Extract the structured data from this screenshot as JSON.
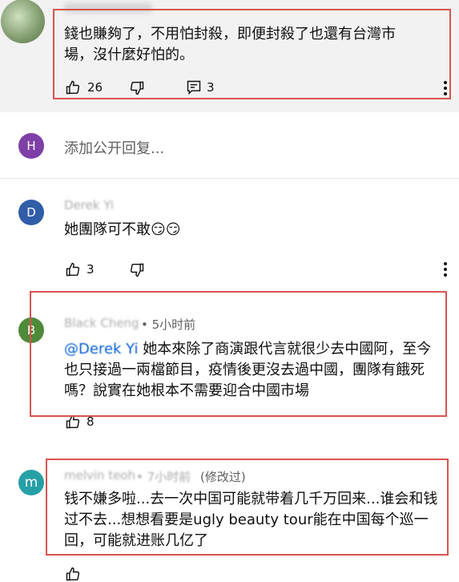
{
  "comment1": {
    "text": "錢也賺夠了，不用怕封殺，即便封殺了也還有台灣市場，沒什麼好怕的。",
    "likes": "26",
    "replies": "3"
  },
  "reply_box": {
    "avatar_letter": "H",
    "placeholder": "添加公开回复..."
  },
  "comment2": {
    "avatar_letter": "D",
    "author": "Derek Yi",
    "text": "她團隊可不敢😏😏",
    "likes": "3"
  },
  "comment3": {
    "avatar_letter": "B",
    "author": "Black Cheng",
    "time": "• 5小时前",
    "mention": "@Derek Yi",
    "text": "她本來除了商演跟代言就很少去中國阿，至今也只接過一兩檔節目，疫情後更沒去過中國，團隊有餓死嗎？說實在她根本不需要迎合中國市場",
    "likes": "8"
  },
  "comment4": {
    "avatar_letter": "m",
    "author": "melvin teoh",
    "time": "• 7小时前",
    "edited": "(修改过)",
    "text": "钱不嫌多啦...去一次中国可能就带着几千万回来...谁会和钱过不去...想想看要是ugly beauty tour能在中国每个巡一回，可能就进账几亿了"
  },
  "colors": {
    "highlight_border": "#d9534f",
    "avatar_h": "#7e3fa7",
    "avatar_d": "#2f5da8",
    "avatar_b": "#4e8a3a",
    "avatar_m": "#26a0a7",
    "link": "#065fd4"
  },
  "icons": [
    "thumbs-up-icon",
    "thumbs-down-icon",
    "reply-icon",
    "more-vert-icon"
  ]
}
